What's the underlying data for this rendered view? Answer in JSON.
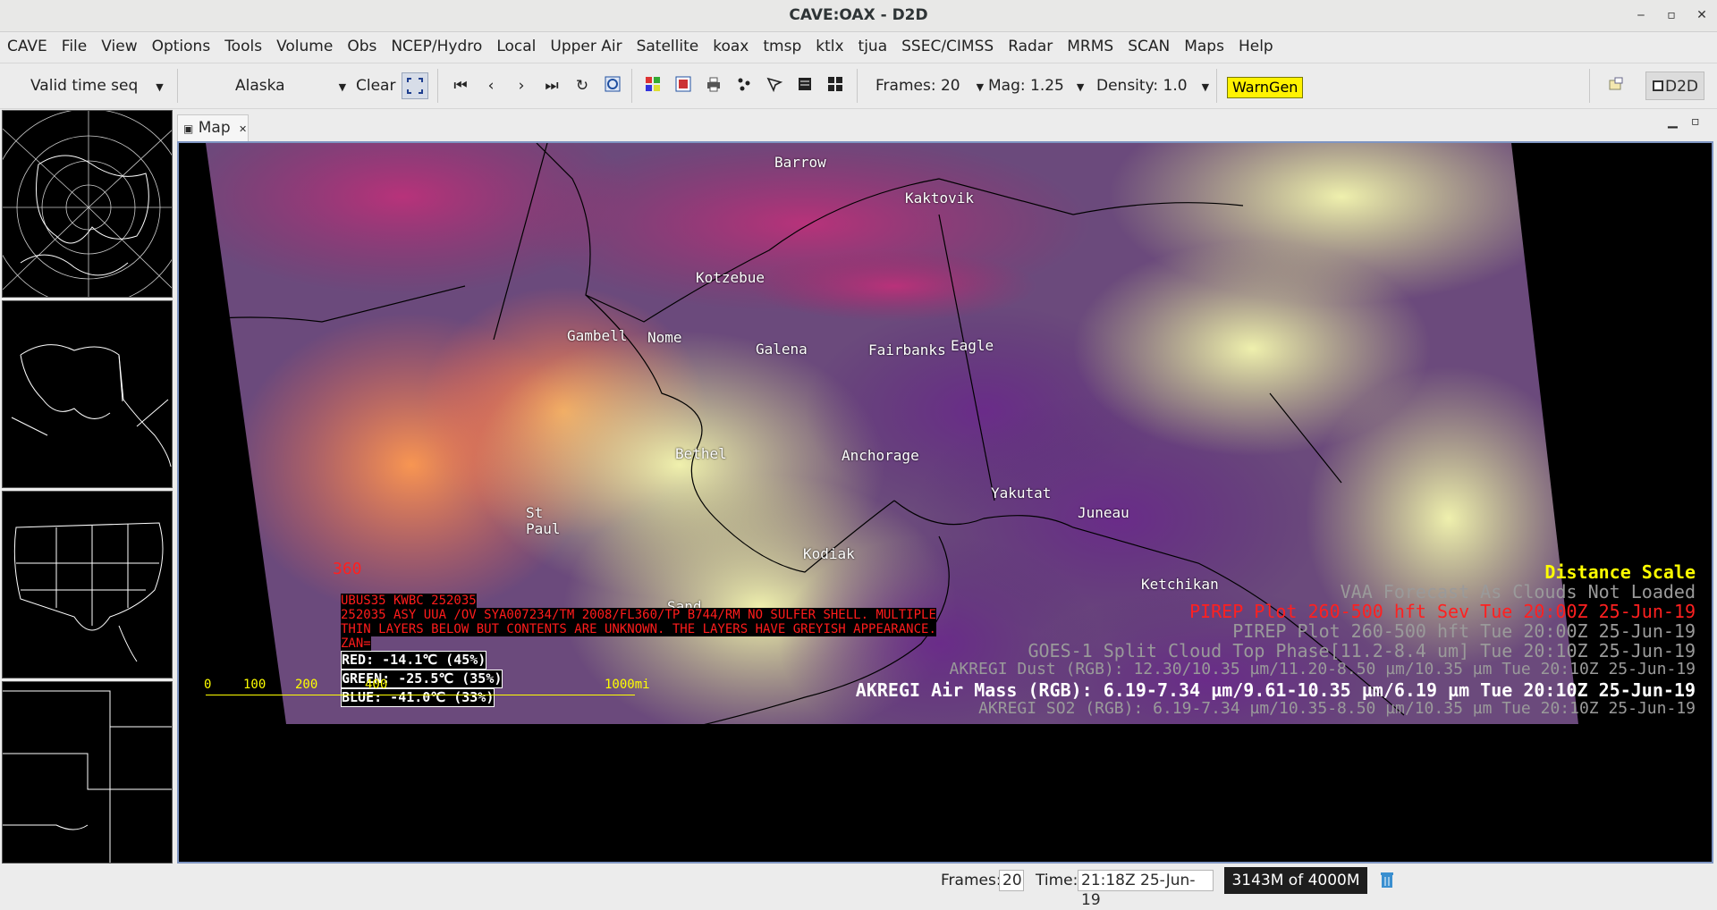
{
  "window": {
    "title": "CAVE:OAX - D2D",
    "minimize": "‒",
    "maximize": "▫",
    "close": "✕"
  },
  "menu": [
    "CAVE",
    "File",
    "View",
    "Options",
    "Tools",
    "Volume",
    "Obs",
    "NCEP/Hydro",
    "Local",
    "Upper Air",
    "Satellite",
    "koax",
    "tmsp",
    "ktlx",
    "tjua",
    "SSEC/CIMSS",
    "Radar",
    "MRMS",
    "SCAN",
    "Maps",
    "Help"
  ],
  "toolbar": {
    "time_mode": "Valid time seq",
    "scale": "Alaska",
    "clear": "Clear",
    "frames": "Frames: 20",
    "mag": "Mag: 1.25",
    "density": "Density: 1.0",
    "warngen": "WarnGen",
    "perspective": "D2D"
  },
  "tab": {
    "label": "Map"
  },
  "map": {
    "cities": [
      "Barrow",
      "Kaktovik",
      "Kotzebue",
      "Gambell",
      "Nome",
      "Galena",
      "Fairbanks",
      "Eagle",
      "Bethel",
      "Anchorage",
      "Yakutat",
      "Juneau",
      "St",
      "Paul",
      "Kodiak",
      "Ketchikan",
      "Sand"
    ],
    "flight_level": "360",
    "pirep": {
      "header": "UBUS35 KWBC 252035",
      "line1": "252035 ASY UUA /OV SYA007234/TM 2008/FL360/TP B744/RM NO SULFER SHELL. MULTIPLE",
      "line2": "THIN LAYERS BELOW BUT CONTENTS ARE UNKNOWN. THE LAYERS HAVE GREYISH APPEARANCE.",
      "line3": "ZAN="
    },
    "sample": {
      "red": "RED: -14.1℃ (45%)",
      "green": "GREEN: -25.5℃ (35%)",
      "blue": "BLUE: -41.0℃ (33%)"
    },
    "scale_bar": {
      "t0": "0",
      "t1": "100",
      "t2": "200",
      "t3": "400",
      "t4": "1000mi"
    },
    "legend": {
      "l1": "Distance Scale",
      "l2": "VAA Forecast As Clouds Not Loaded",
      "l3": "PIREP Plot 260-500 hft Sev Tue 20:00Z 25-Jun-19",
      "l4": "PIREP Plot 260-500 hft Tue 20:00Z 25-Jun-19",
      "l5": "GOES-1  Split Cloud Top Phase[11.2-8.4 um]   Tue 20:10Z 25-Jun-19",
      "l6": "AKREGI Dust (RGB): 12.30/10.35 µm/11.20-8.50 µm/10.35 µm Tue 20:10Z 25-Jun-19",
      "l7": "AKREGI Air Mass (RGB): 6.19-7.34 µm/9.61-10.35 µm/6.19 µm Tue 20:10Z 25-Jun-19",
      "l8": "AKREGI SO2 (RGB): 6.19-7.34 µm/10.35-8.50 µm/10.35 µm Tue 20:10Z 25-Jun-19"
    }
  },
  "status": {
    "frames_label": "Frames:",
    "frames_value": "20",
    "time_label": "Time:",
    "time_value": "21:18Z 25-Jun-19",
    "memory": "3143M of 4000M"
  },
  "colors": {
    "warngen": "#fff200",
    "legend_yellow": "#ffff00",
    "legend_red": "#ff2020",
    "pirep_red": "#ff1c1c",
    "frame_border": "#7f95c2"
  },
  "icons": [
    "first-frame-icon",
    "previous-frame-icon",
    "next-frame-icon",
    "last-frame-icon",
    "loop-icon",
    "loop-properties-icon",
    "image-properties-icon",
    "image-combine-icon",
    "print-icon",
    "sample-icon",
    "cursor-icon",
    "panel-layout-1-icon",
    "panel-layout-4-icon",
    "perspective-icon",
    "trash-icon"
  ]
}
